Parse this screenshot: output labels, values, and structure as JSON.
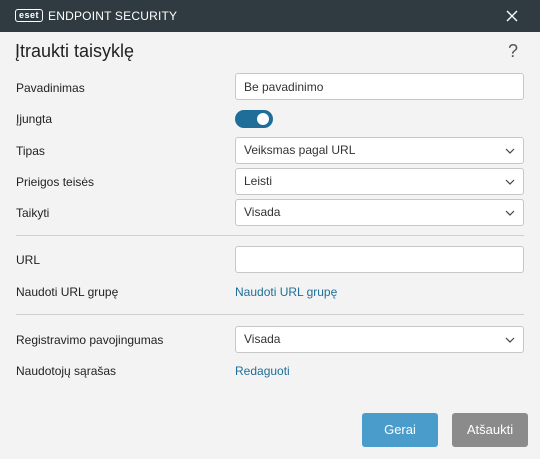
{
  "titlebar": {
    "logo_badge": "eset",
    "logo_text": "ENDPOINT SECURITY",
    "close_icon": "close-icon"
  },
  "dialog": {
    "title": "Įtraukti taisyklę",
    "help": "?"
  },
  "form": {
    "name_label": "Pavadinimas",
    "name_value": "Be pavadinimo",
    "enabled_label": "Įjungta",
    "enabled": true,
    "type_label": "Tipas",
    "type_value": "Veiksmas pagal URL",
    "access_label": "Prieigos teisės",
    "access_value": "Leisti",
    "apply_label": "Taikyti",
    "apply_value": "Visada",
    "url_label": "URL",
    "url_value": "",
    "use_group_label": "Naudoti URL grupę",
    "use_group_link": "Naudoti URL grupę",
    "log_severity_label": "Registravimo pavojingumas",
    "log_severity_value": "Visada",
    "user_list_label": "Naudotojų sąrašas",
    "user_list_link": "Redaguoti"
  },
  "buttons": {
    "ok": "Gerai",
    "cancel": "Atšaukti"
  },
  "colors": {
    "titlebar": "#2f3a41",
    "accent": "#1f6e99",
    "ok_button": "#4a9ccb",
    "cancel_button": "#8b8b8b"
  }
}
